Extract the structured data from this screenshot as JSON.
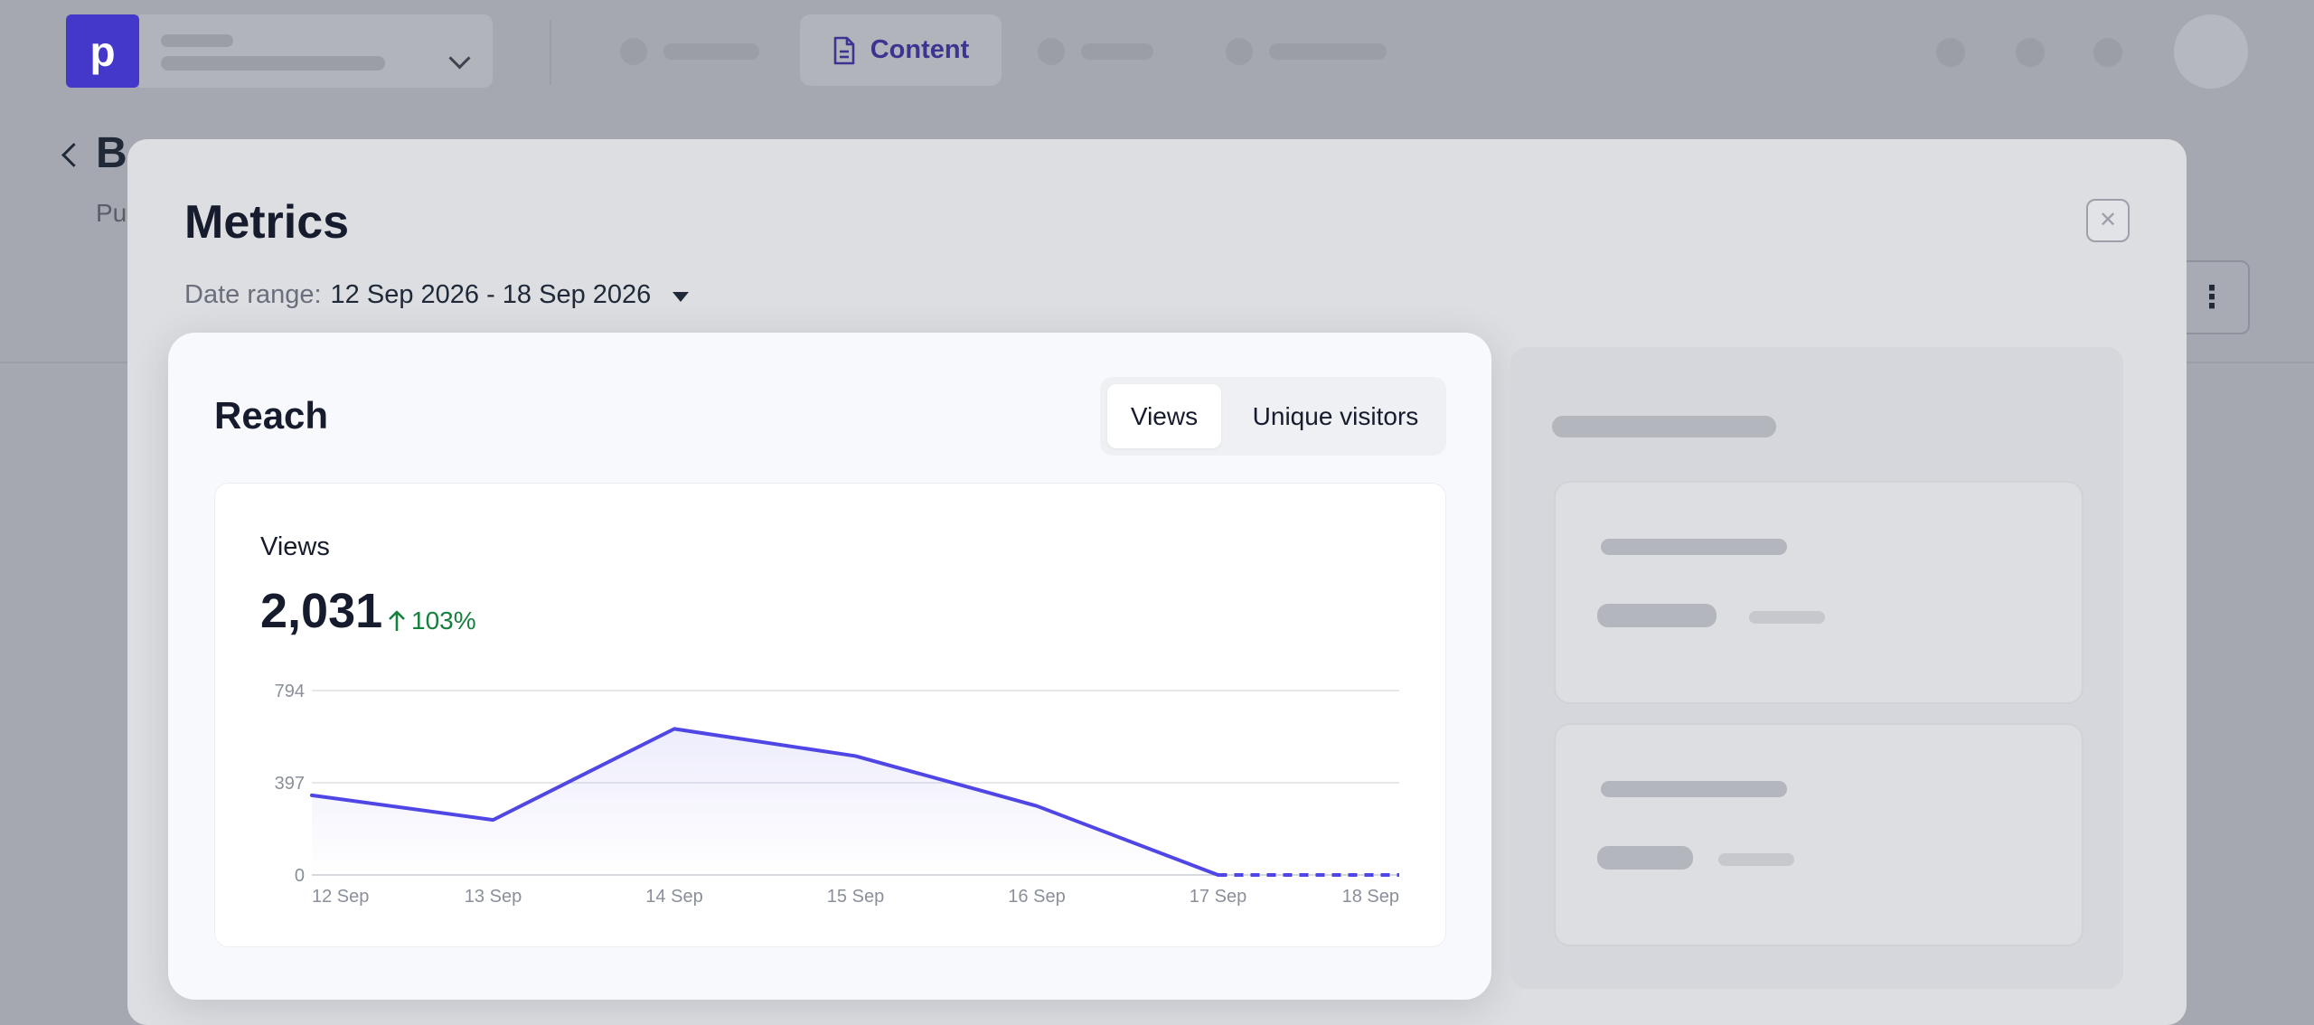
{
  "app": {
    "logo_letter": "p",
    "nav": {
      "active_label": "Content"
    },
    "page": {
      "title": "B",
      "subtitle": "Pu"
    }
  },
  "modal": {
    "title": "Metrics",
    "close_symbol": "✕",
    "date_range": {
      "label": "Date range:",
      "value": "12 Sep 2026 - 18 Sep 2026"
    },
    "reach": {
      "title": "Reach",
      "tabs": [
        {
          "label": "Views",
          "selected": true
        },
        {
          "label": "Unique visitors",
          "selected": false
        }
      ],
      "metric": {
        "label": "Views",
        "value": "2,031",
        "change": "103%",
        "change_direction": "up"
      }
    }
  },
  "colors": {
    "accent": "#4f46e5",
    "logo": "#4338ca",
    "positive": "#15803d"
  },
  "icons": [
    "chevron-down-icon",
    "document-icon",
    "chevron-left-icon",
    "more-vertical-icon",
    "close-icon",
    "caret-down-icon",
    "arrow-up-icon"
  ],
  "chart_data": {
    "type": "line",
    "categories": [
      "12 Sep",
      "13 Sep",
      "14 Sep",
      "15 Sep",
      "16 Sep",
      "17 Sep",
      "18 Sep"
    ],
    "values": [
      343,
      237,
      629,
      512,
      297,
      0,
      0
    ],
    "projected_from_index": 5,
    "y_ticks": [
      0,
      397,
      794
    ],
    "ylim": [
      0,
      794
    ],
    "grid": true,
    "area_fill": true,
    "series_color": "#4f46e5"
  }
}
